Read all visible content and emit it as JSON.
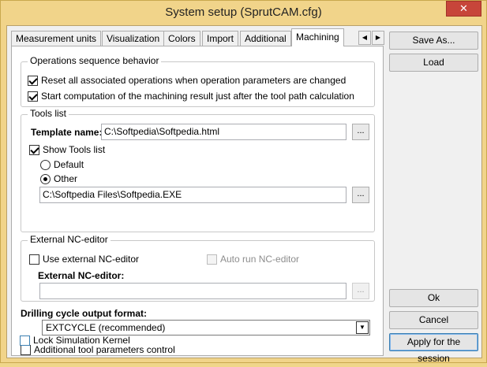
{
  "window": {
    "title": "System setup (SprutCAM.cfg)",
    "close_glyph": "✕"
  },
  "tabs": {
    "items": [
      "Measurement units",
      "Visualization",
      "Colors",
      "Import",
      "Additional",
      "Machining"
    ],
    "active": "Machining",
    "scroll_left": "◀",
    "scroll_right": "▶"
  },
  "operations": {
    "group_label": "Operations sequence behavior",
    "reset_label": "Reset all associated operations when operation parameters are changed",
    "reset_checked": true,
    "start_label": "Start computation of the machining result just after the tool path calculation",
    "start_checked": true
  },
  "tools_list": {
    "group_label": "Tools list",
    "template_label": "Template name:",
    "template_value": "C:\\Softpedia\\Softpedia.html",
    "browse_label": "...",
    "show_label": "Show Tools list",
    "show_checked": true,
    "default_label": "Default",
    "other_label": "Other",
    "selected_option": "Other",
    "other_path": "C:\\Softpedia Files\\Softpedia.EXE",
    "other_browse_label": "..."
  },
  "nc_editor": {
    "group_label": "External NC-editor",
    "use_label": "Use external NC-editor",
    "use_checked": false,
    "auto_run_label": "Auto run NC-editor",
    "field_label": "External NC-editor:",
    "field_value": "",
    "browse_label": "..."
  },
  "drilling": {
    "label": "Drilling cycle output format:",
    "selected": "EXTCYCLE (recommended)"
  },
  "options": {
    "additional_label": "Additional tool parameters control",
    "additional_checked": false,
    "lock_label": "Lock Simulation Kernel",
    "lock_checked": false
  },
  "buttons": {
    "save_as": "Save As...",
    "load": "Load",
    "ok": "Ok",
    "cancel": "Cancel",
    "apply": "Apply for the session"
  }
}
